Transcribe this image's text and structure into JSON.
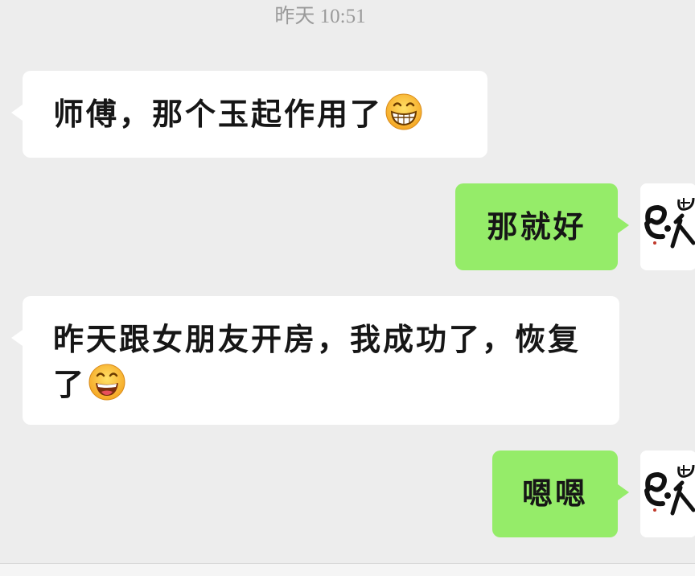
{
  "chat": {
    "timestamp": "昨天 10:51",
    "messages": [
      {
        "side": "left",
        "text": "师傅，那个玉起作用了",
        "emoji": "grinning-face-emoji"
      },
      {
        "side": "right",
        "text": "那就好"
      },
      {
        "side": "left",
        "text": "昨天跟女朋友开房，我成功了，恢复了",
        "emoji": "smiling-face-emoji"
      },
      {
        "side": "right",
        "text": "嗯嗯"
      }
    ]
  },
  "colors": {
    "background": "#ededed",
    "incoming_bubble": "#ffffff",
    "outgoing_bubble": "#95ec69",
    "timestamp": "#9a9a9a"
  }
}
